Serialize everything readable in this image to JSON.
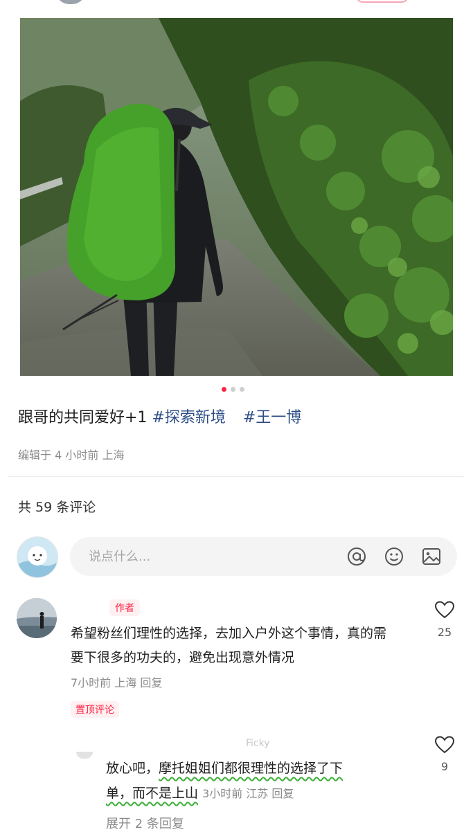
{
  "post": {
    "caption_text": "跟哥的共同爱好+1",
    "tags": [
      "#探索新境",
      "#王一博"
    ],
    "meta": "编辑于 4 小时前 上海",
    "image_page_index": 0,
    "image_page_total": 3
  },
  "comments_section": {
    "count_label": "共 59 条评论",
    "input_placeholder": "说点什么..."
  },
  "comments": [
    {
      "author_tag": "作者",
      "text": "希望粉丝们理性的选择，去加入户外这个事情，真的需要下很多的功夫的，避免出现意外情况",
      "meta": "7小时前 上海 回复",
      "pinned_label": "置顶评论",
      "likes": "25"
    }
  ],
  "reply": {
    "name_partial": "Ficky",
    "text_before": "放心吧，",
    "text_highlight_1": "摩托姐姐们都很理性的选择了下",
    "text_highlight_2": "单，而不是上山",
    "meta": "3小时前 江苏 回复",
    "more_label": "展开 2 条回复",
    "likes": "9"
  },
  "colors": {
    "accent": "#ff2442",
    "tag_blue": "#2c4d86",
    "wavy_underline": "#3fae3a"
  },
  "icons": [
    "at-icon",
    "emoji-icon",
    "image-icon",
    "heart-icon"
  ]
}
